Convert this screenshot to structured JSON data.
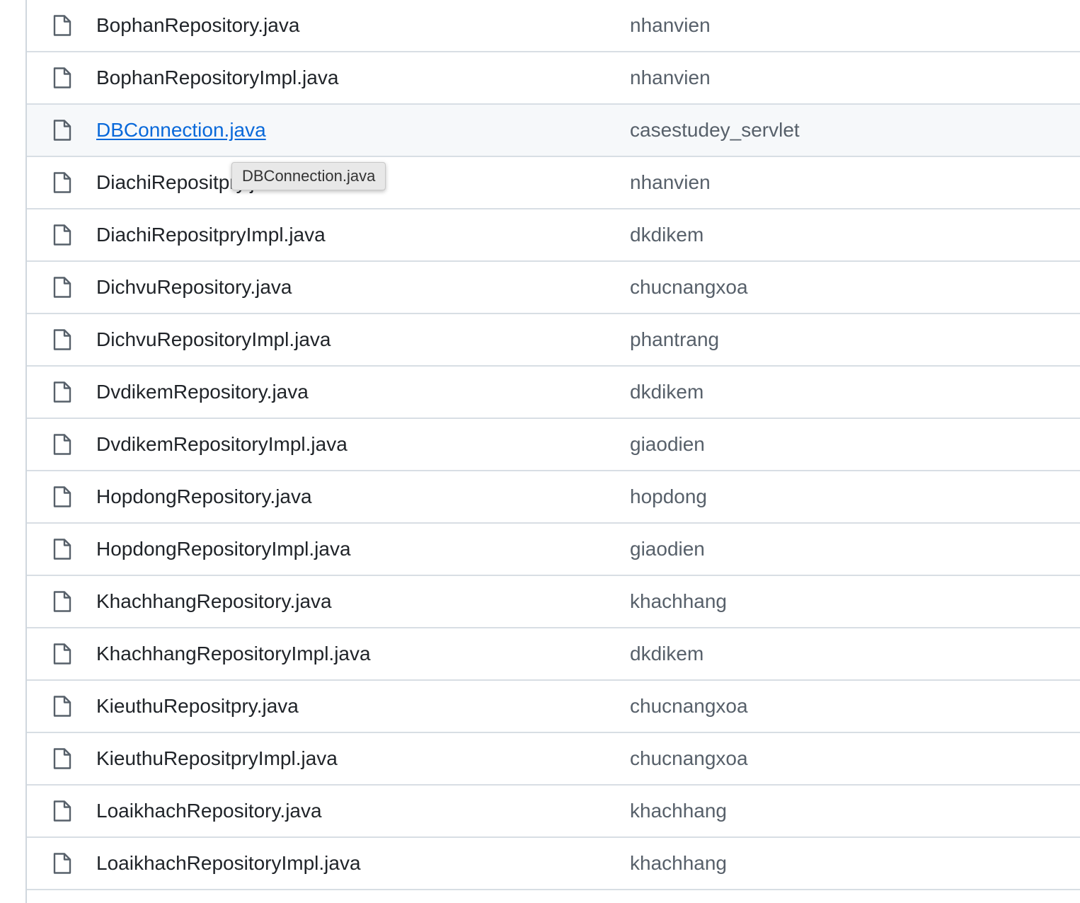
{
  "files": [
    {
      "name": "BophanRepository.java",
      "commit": "nhanvien"
    },
    {
      "name": "BophanRepositoryImpl.java",
      "commit": "nhanvien"
    },
    {
      "name": "DBConnection.java",
      "commit": "casestudey_servlet"
    },
    {
      "name": "DiachiRepositpry.java",
      "commit": "nhanvien"
    },
    {
      "name": "DiachiRepositpryImpl.java",
      "commit": "dkdikem"
    },
    {
      "name": "DichvuRepository.java",
      "commit": "chucnangxoa"
    },
    {
      "name": "DichvuRepositoryImpl.java",
      "commit": "phantrang"
    },
    {
      "name": "DvdikemRepository.java",
      "commit": "dkdikem"
    },
    {
      "name": "DvdikemRepositoryImpl.java",
      "commit": "giaodien"
    },
    {
      "name": "HopdongRepository.java",
      "commit": "hopdong"
    },
    {
      "name": "HopdongRepositoryImpl.java",
      "commit": "giaodien"
    },
    {
      "name": "KhachhangRepository.java",
      "commit": "khachhang"
    },
    {
      "name": "KhachhangRepositoryImpl.java",
      "commit": "dkdikem"
    },
    {
      "name": "KieuthuRepositpry.java",
      "commit": "chucnangxoa"
    },
    {
      "name": "KieuthuRepositpryImpl.java",
      "commit": "chucnangxoa"
    },
    {
      "name": "LoaikhachRepository.java",
      "commit": "khachhang"
    },
    {
      "name": "LoaikhachRepositoryImpl.java",
      "commit": "khachhang"
    }
  ],
  "hovered_index": 2,
  "tooltip": {
    "text": "DBConnection.java"
  },
  "icons": {
    "file": "file-icon"
  },
  "colors": {
    "link": "#0969da",
    "text": "#1f2328",
    "muted": "#57606a",
    "hover_bg": "#f6f8fa",
    "border": "#d8dee4"
  }
}
